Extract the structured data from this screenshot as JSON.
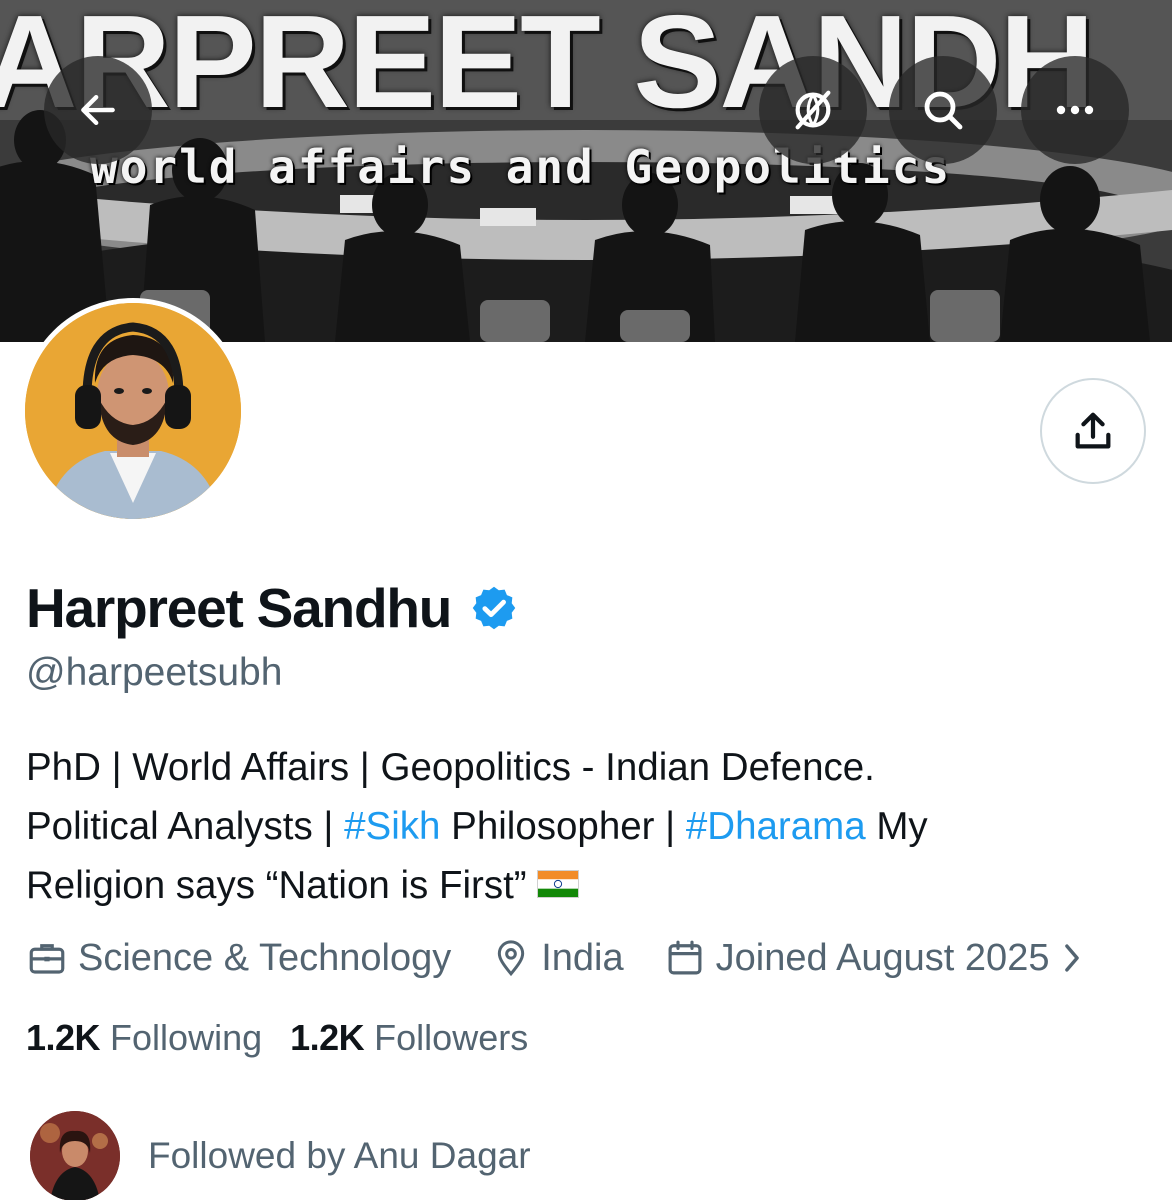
{
  "banner": {
    "title": "ARPREET SANDH",
    "subtitle": "world affairs and Geopolitics"
  },
  "header_buttons": {
    "back_icon": "arrow-left-icon",
    "translate_icon": "globe-slash-icon",
    "search_icon": "search-icon",
    "more_icon": "more-dots-icon"
  },
  "profile": {
    "name": "Harpreet Sandhu",
    "handle": "@harpeetsubh",
    "verified": true,
    "bio": {
      "line1": "PhD | World Affairs | Geopolitics - Indian Defence.",
      "line2_a": "Political Analysts | ",
      "line2_tag1": "#Sikh",
      "line2_b": " Philosopher | ",
      "line2_tag2": "#Dharama",
      "line2_c": " My",
      "line3": "Religion says “Nation is First”"
    },
    "category": "Science & Technology",
    "location": "India",
    "joined": "Joined August 2025",
    "following_count": "1.2K",
    "following_label": "Following",
    "followers_count": "1.2K",
    "followers_label": "Followers",
    "followed_by": "Followed by Anu Dagar"
  },
  "colors": {
    "link": "#1d9bf0",
    "secondary_text": "#536471",
    "verified_badge": "#1d9bf0",
    "avatar_background": "#e9a634"
  }
}
